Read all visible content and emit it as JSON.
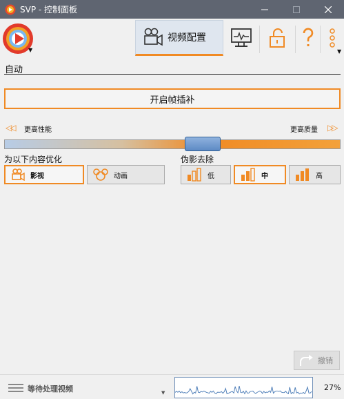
{
  "window": {
    "title": "SVP - 控制面板",
    "buttons": [
      "minimize",
      "maximize",
      "close"
    ]
  },
  "toolbar": {
    "tab_video_label": "视频配置",
    "icons": [
      "svp-logo-icon",
      "video-camera-icon",
      "monitor-icon",
      "unlock-icon",
      "help-icon",
      "more-icon"
    ]
  },
  "mode": {
    "label": "自动"
  },
  "main_button": {
    "label": "开启帧插补"
  },
  "quality_scale": {
    "left_label": "更高性能",
    "right_label": "更高质量",
    "position": 0.6
  },
  "optimize": {
    "label": "为以下内容优化",
    "options": [
      {
        "label": "影视",
        "selected": true
      },
      {
        "label": "动画",
        "selected": false
      }
    ]
  },
  "artifact": {
    "label": "伪影去除",
    "options": [
      {
        "label": "低",
        "selected": false
      },
      {
        "label": "中",
        "selected": true
      },
      {
        "label": "高",
        "selected": false
      }
    ]
  },
  "undo": {
    "label": "撤销"
  },
  "status": {
    "text": "等待处理视频",
    "cpu": "27%"
  },
  "colors": {
    "accent": "#f08a24",
    "titlebar": "#5f6571",
    "slider_thumb": "#5d8ac4",
    "graph_line": "#4f7fb9"
  }
}
